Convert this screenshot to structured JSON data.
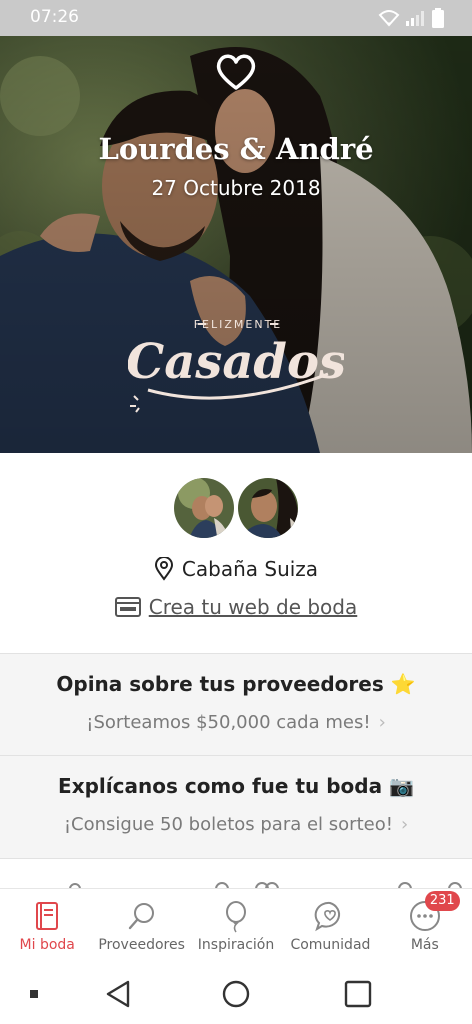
{
  "status_bar": {
    "time": "07:26"
  },
  "hero": {
    "names": "Lourdes & André",
    "date": "27 Octubre 2018",
    "stamp_small": "FELIZMENTE",
    "stamp_main": "Casados"
  },
  "profile": {
    "location": "Cabaña Suiza",
    "web_link": "Crea tu web de boda"
  },
  "cards": [
    {
      "title": "Opina sobre tus proveedores ⭐",
      "subtitle": "¡Sorteamos $50,000 cada mes!",
      "chevron": "›"
    },
    {
      "title": "Explícanos como fue tu boda 📷",
      "subtitle": "¡Consigue 50 boletos para el sorteo!",
      "chevron": "›"
    }
  ],
  "tabs": [
    {
      "label": "Mi boda",
      "icon": "notebook-icon",
      "active": true
    },
    {
      "label": "Proveedores",
      "icon": "search-icon"
    },
    {
      "label": "Inspiración",
      "icon": "balloon-icon"
    },
    {
      "label": "Comunidad",
      "icon": "chat-heart-icon"
    },
    {
      "label": "Más",
      "icon": "more-icon",
      "badge": "231"
    }
  ],
  "colors": {
    "accent": "#e0474c",
    "card_bg": "#f5f5f5",
    "status_bar": "#c9c9c9"
  }
}
